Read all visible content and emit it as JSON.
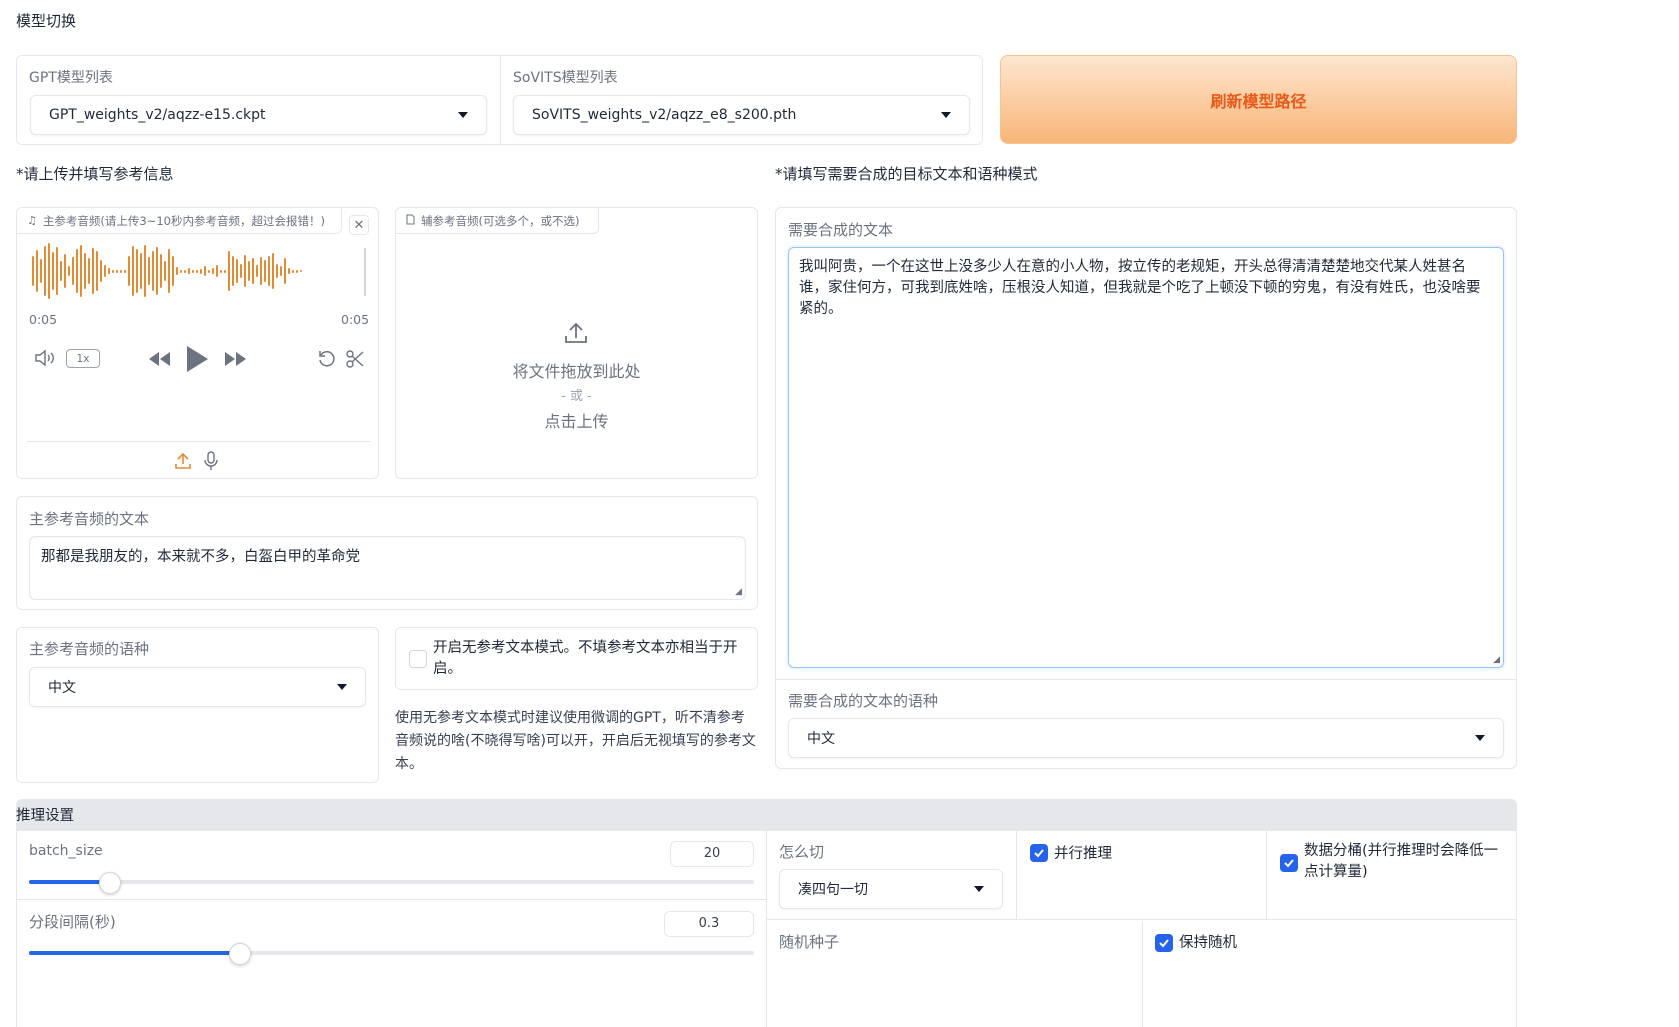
{
  "section_title": "模型切换",
  "gpt": {
    "label": "GPT模型列表",
    "value": "GPT_weights_v2/aqzz-e15.ckpt"
  },
  "sovits": {
    "label": "SoVITS模型列表",
    "value": "SoVITS_weights_v2/aqzz_e8_s200.pth"
  },
  "refresh_button": "刷新模型路径",
  "left_heading": "*请上传并填写参考信息",
  "right_heading": "*请填写需要合成的目标文本和语种模式",
  "main_audio": {
    "tab_label": "主参考音频(请上传3~10秒内参考音频，超过会报错！)",
    "time_start": "0:05",
    "time_end": "0:05",
    "speed": "1x"
  },
  "aux_audio": {
    "tab_label": "辅参考音频(可选多个，或不选)",
    "drop_text": "将文件拖放到此处",
    "or_text": "- 或 -",
    "click_text": "点击上传"
  },
  "ref_text": {
    "label": "主参考音频的文本",
    "value": "那都是我朋友的，本来就不多，白盔白甲的革命党"
  },
  "ref_lang": {
    "label": "主参考音频的语种",
    "value": "中文"
  },
  "no_ref_mode": {
    "label": "开启无参考文本模式。不填参考文本亦相当于开启。",
    "checked": false,
    "hint": "使用无参考文本模式时建议使用微调的GPT，听不清参考音频说的啥(不晓得写啥)可以开，开启后无视填写的参考文本。"
  },
  "target_text": {
    "label": "需要合成的文本",
    "value": "我叫阿贵，一个在这世上没多少人在意的小人物，按立传的老规矩，开头总得清清楚楚地交代某人姓甚名谁，家住何方，可我到底姓啥，压根没人知道，但我就是个吃了上顿没下顿的穷鬼，有没有姓氏，也没啥要紧的。"
  },
  "target_lang": {
    "label": "需要合成的文本的语种",
    "value": "中文"
  },
  "inference": {
    "title": "推理设置",
    "batch_size": {
      "label": "batch_size",
      "value": "20",
      "fraction": 0.11
    },
    "interval": {
      "label": "分段间隔(秒)",
      "value": "0.3",
      "fraction": 0.29
    },
    "cut": {
      "label": "怎么切",
      "value": "凑四句一切"
    },
    "parallel": {
      "label": "并行推理",
      "checked": true
    },
    "bucket": {
      "label": "数据分桶(并行推理时会降低一点计算量)",
      "checked": true
    },
    "seed": {
      "label": "随机种子"
    },
    "keep_random": {
      "label": "保持随机",
      "checked": true
    }
  },
  "colors": {
    "accent": "#2563eb",
    "waveform": "#e28b35",
    "refresh_text": "#e8591a"
  }
}
